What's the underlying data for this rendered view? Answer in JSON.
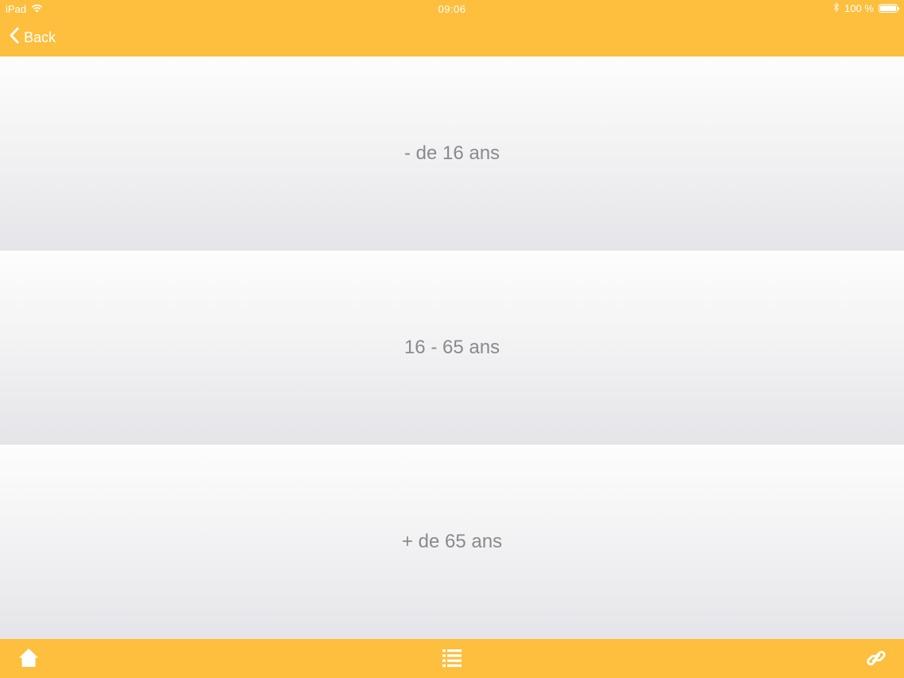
{
  "status_bar": {
    "device": "iPad",
    "time": "09:06",
    "battery": "100 %"
  },
  "nav": {
    "back_label": "Back"
  },
  "options": [
    {
      "label": "- de 16 ans"
    },
    {
      "label": "16 - 65 ans"
    },
    {
      "label": "+ de 65 ans"
    }
  ],
  "tab_bar": {
    "icons": [
      "home-icon",
      "list-icon",
      "link-icon"
    ]
  },
  "colors": {
    "accent": "#fdbf3d",
    "option_text": "#8a898e",
    "bar_text": "#ffffff"
  }
}
